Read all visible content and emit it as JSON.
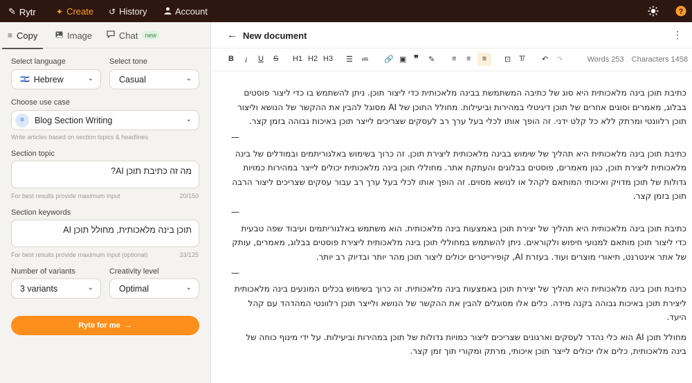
{
  "topbar": {
    "brand": "Rytr",
    "nav": [
      {
        "label": "Create",
        "icon": "sparkle-icon",
        "active": true
      },
      {
        "label": "History",
        "icon": "history-icon",
        "active": false
      },
      {
        "label": "Account",
        "icon": "user-icon",
        "active": false
      }
    ]
  },
  "left_tabs": [
    {
      "label": "Copy",
      "icon": "list-icon"
    },
    {
      "label": "Image",
      "icon": "image-icon"
    },
    {
      "label": "Chat",
      "icon": "chat-icon",
      "badge": "new"
    }
  ],
  "form": {
    "language_label": "Select language",
    "language_value": "Hebrew",
    "language_flag": "🇮🇱",
    "tone_label": "Select tone",
    "tone_value": "Casual",
    "usecase_label": "Choose use case",
    "usecase_value": "Blog Section Writing",
    "usecase_hint": "Write articles based on section topics & headlines",
    "topic_label": "Section topic",
    "topic_value": "מה זה כתיבת תוכן AI?",
    "topic_hint": "For best results provide maximum input",
    "topic_count": "20/150",
    "keywords_label": "Section keywords",
    "keywords_value": "תוכן בינה מלאכותית, מחולל תוכן AI",
    "keywords_hint": "For best results provide maximum input (optional)",
    "keywords_count": "33/125",
    "variants_label": "Number of variants",
    "variants_value": "3 variants",
    "creativity_label": "Creativity level",
    "creativity_value": "Optimal",
    "button_label": "Ryte for me"
  },
  "editor": {
    "title": "New document",
    "toolbar": [
      "B",
      "i",
      "U",
      "S",
      "H1",
      "H2",
      "H3"
    ],
    "words_label": "Words 253",
    "characters_label": "Characters 1458",
    "separator": "—",
    "paragraphs": [
      "כתיבת תוכן בינה מלאכותית היא סוג של כתיבה המשתמשת בבינה מלאכותית כדי ליצור תוכן. ניתן להשתמש בו כדי ליצור פוסטים בבלוג, מאמרים וסוגים אחרים של תוכן דיגיטלי במהירות וביעילות. מחולל התוכן של AI מסוגל להבין את ההקשר של הנושא וליצור תוכן רלוונטי ומרתק ללא כל קלט ידני. זה הופך אותו לכלי בעל ערך רב לעסקים שצריכים לייצר תוכן באיכות גבוהה בזמן קצר.",
      "כתיבת תוכן בינה מלאכותית היא תהליך של שימוש בבינה מלאכותית ליצירת תוכן. זה כרוך בשימוש באלגוריתמים ובמודלים של בינה מלאכותית ליצירת תוכן, כגון מאמרים, פוסטים בבלוגים והעתקת אתר. מחוללי תוכן בינה מלאכותית יכולים לייצר במהירות כמויות גדולות של תוכן מדויק ואיכותי המותאם לקהל או לנושא מסוים. זה הופך אותו לכלי בעל ערך רב עבור עסקים שצריכים ליצור הרבה תוכן בזמן קצר.",
      "כתיבת תוכן בינה מלאכותית היא תהליך של יצירת תוכן באמצעות בינה מלאכותית. הוא משתמש באלגוריתמים ועיבוד שפה טבעית כדי ליצור תוכן מותאם למנועי חיפוש ולקוראים. ניתן להשתמש במחוללי תוכן בינה מלאכותית ליצירת פוסטים בבלוג, מאמרים, עותק של אתר אינטרנט, תיאורי מוצרים ועוד. בעזרת AI, קופירייטרים יכולים ליצור תוכן מהר יותר ובדיוק רב יותר.",
      "כתיבת תוכן בינה מלאכותית היא תהליך של יצירת תוכן באמצעות בינה מלאכותית. זה כרוך בשימוש בכלים המונעים בינה מלאכותית ליצירת תוכן באיכות גבוהה בקנה מידה. כלים אלו מסוגלים להבין את ההקשר של הנושא ולייצר תוכן רלוונטי המהדהד עם קהל היעד.",
      "מחולל תוכן AI הוא כלי נהדר לעסקים וארגונים שצריכים ליצור כמויות גדולות של תוכן במהירות וביעילות. על ידי מינוף כוחה של בינה מלאכותית, כלים אלו יכולים לייצר תוכן איכותי, מרתק ומקורי תוך זמן קצר."
    ]
  }
}
